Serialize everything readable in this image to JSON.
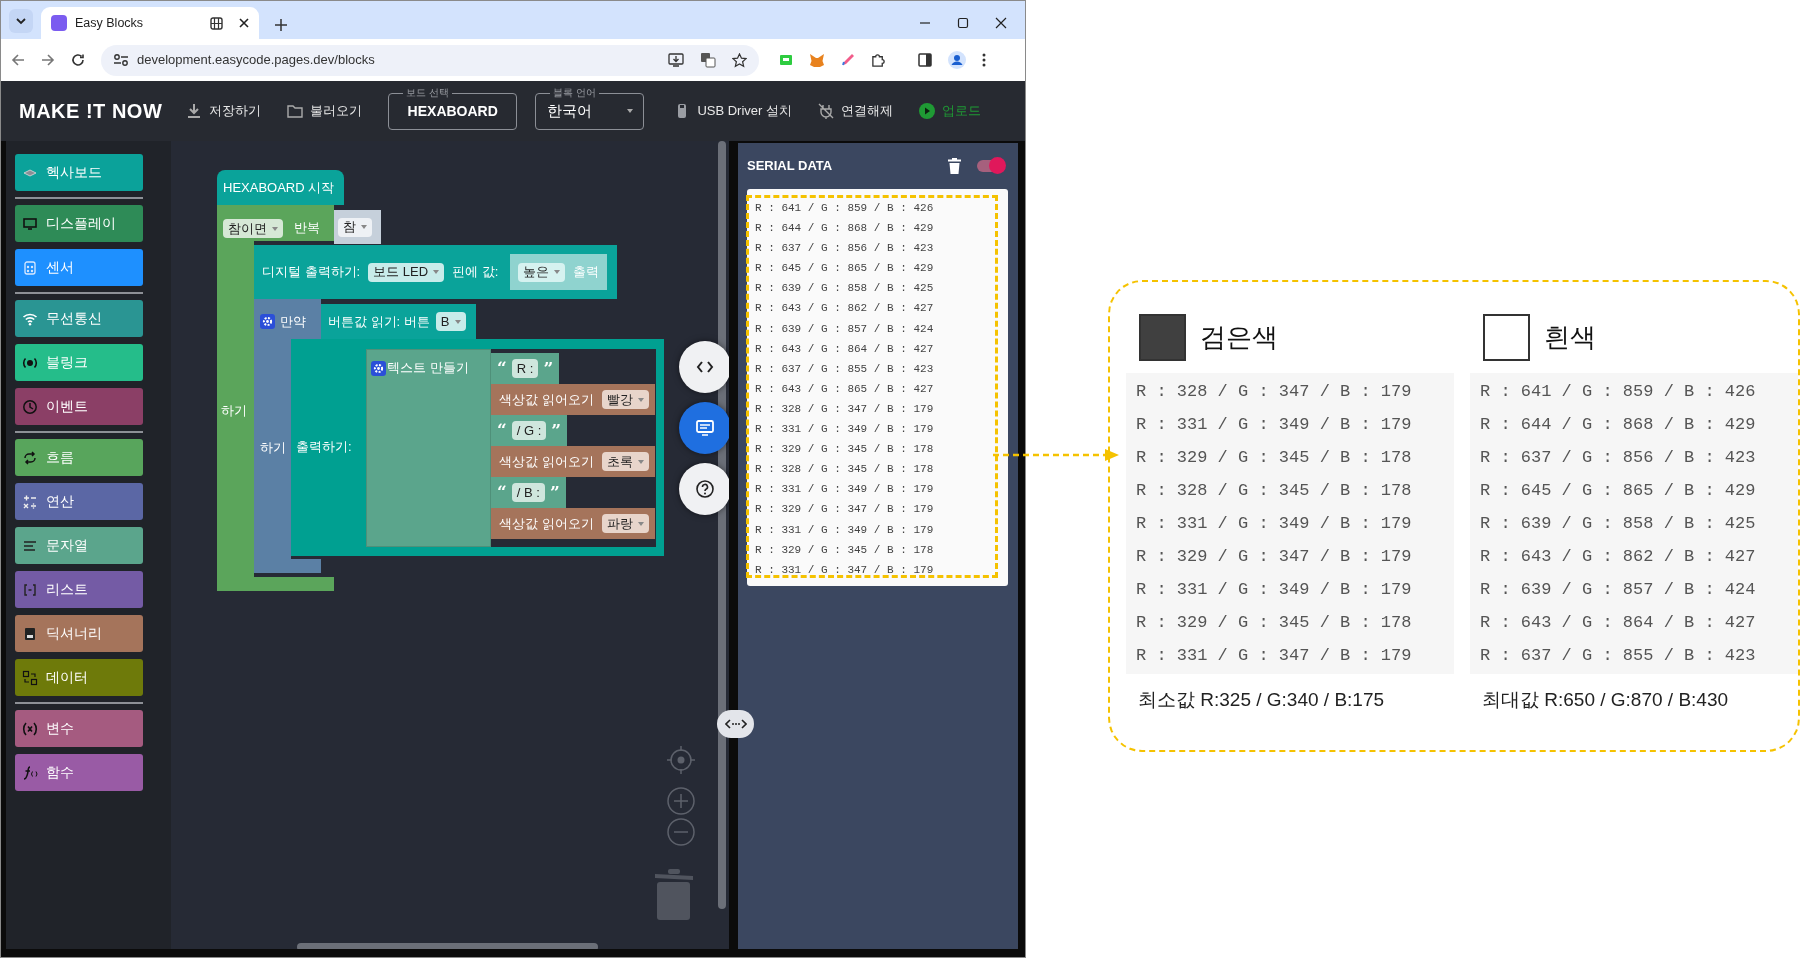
{
  "browser": {
    "tab_title": "Easy Blocks",
    "url": "development.easycode.pages.dev/blocks"
  },
  "app_bar": {
    "logo": "MAKE !T NOW",
    "file_actions": [
      {
        "kind": "save",
        "label": "저장하기"
      },
      {
        "kind": "open",
        "label": "불러오기"
      }
    ],
    "board_select": {
      "legend": "보드 선택",
      "value": "HEXABOARD"
    },
    "language_select": {
      "legend": "블록 언어",
      "value": "한국어"
    },
    "device_actions": [
      {
        "kind": "usb",
        "label": "USB Driver 설치"
      },
      {
        "kind": "disconnect",
        "label": "연결해제"
      },
      {
        "kind": "upload",
        "label": "업로드"
      }
    ]
  },
  "category_groups": [
    {
      "items": [
        {
          "kind": "chip",
          "label": "헥사보드",
          "color": "#0ba29a"
        }
      ]
    },
    {
      "items": [
        {
          "kind": "display",
          "label": "디스플레이",
          "color": "#2e8b57"
        },
        {
          "kind": "sensor",
          "label": "센서",
          "color": "#1e90ff"
        }
      ]
    },
    {
      "items": [
        {
          "kind": "wifi",
          "label": "무선통신",
          "color": "#2a9593"
        },
        {
          "kind": "iot",
          "label": "블링크",
          "color": "#25bd8a"
        },
        {
          "kind": "clock",
          "label": "이벤트",
          "color": "#8b3f66"
        }
      ]
    },
    {
      "items": [
        {
          "kind": "loop",
          "label": "흐름",
          "color": "#58a55c"
        },
        {
          "kind": "math",
          "label": "연산",
          "color": "#5b67a5"
        },
        {
          "kind": "text",
          "label": "문자열",
          "color": "#5ba58c"
        },
        {
          "kind": "list",
          "label": "리스트",
          "color": "#745ba5"
        },
        {
          "kind": "dict",
          "label": "딕셔너리",
          "color": "#a5745b"
        },
        {
          "kind": "data",
          "label": "데이터",
          "color": "#6e7a0a"
        }
      ]
    },
    {
      "items": [
        {
          "kind": "variable",
          "label": "변수",
          "color": "#a55b80"
        },
        {
          "kind": "function",
          "label": "함수",
          "color": "#995ba5"
        }
      ]
    }
  ],
  "workspace": {
    "start": {
      "label": "HEXABOARD 시작"
    },
    "loop": {
      "mode": "참이면",
      "label": "반복",
      "condition": "참",
      "do_label": "하기"
    },
    "digital_write": {
      "label": "디지털 출력하기:",
      "pin": "보드 LED",
      "value_label": "핀에 값:",
      "value": "높은",
      "value_suffix": "출력"
    },
    "if_block": {
      "label": "만약",
      "condition_label": "버튼값 읽기: 버튼",
      "button": "B",
      "do_label": "하기"
    },
    "print": {
      "label": "출력하기:"
    },
    "join": {
      "label": "텍스트 만들기",
      "parts": [
        {
          "kind": "text",
          "open": "“",
          "value": "R :",
          "close": "”"
        },
        {
          "kind": "color_read",
          "label": "색상값 읽어오기",
          "channel": "빨강"
        },
        {
          "kind": "text",
          "open": "“",
          "value": "/ G :",
          "close": "”"
        },
        {
          "kind": "color_read",
          "label": "색상값 읽어오기",
          "channel": "초록"
        },
        {
          "kind": "text",
          "open": "“",
          "value": "/ B :",
          "close": "”"
        },
        {
          "kind": "color_read",
          "label": "색상값 읽어오기",
          "channel": "파랑"
        }
      ]
    },
    "side_buttons": [
      {
        "kind": "code",
        "selected": false
      },
      {
        "kind": "console",
        "selected": true
      },
      {
        "kind": "help",
        "selected": false
      }
    ]
  },
  "serial": {
    "title": "SERIAL DATA",
    "enabled": true,
    "lines": [
      "R : 641 / G : 859 / B : 426",
      "R : 644 / G : 868 / B : 429",
      "R : 637 / G : 856 / B : 423",
      "R : 645 / G : 865 / B : 429",
      "R : 639 / G : 858 / B : 425",
      "R : 643 / G : 862 / B : 427",
      "R : 639 / G : 857 / B : 424",
      "R : 643 / G : 864 / B : 427",
      "R : 637 / G : 855 / B : 423",
      "R : 643 / G : 865 / B : 427",
      "R : 328 / G : 347 / B : 179",
      "R : 331 / G : 349 / B : 179",
      "R : 329 / G : 345 / B : 178",
      "R : 328 / G : 345 / B : 178",
      "R : 331 / G : 349 / B : 179",
      "R : 329 / G : 347 / B : 179",
      "R : 331 / G : 349 / B : 179",
      "R : 329 / G : 345 / B : 178",
      "R : 331 / G : 347 / B : 179"
    ]
  },
  "comparison": {
    "columns": [
      {
        "label": "검은색",
        "color": "#404040",
        "lines": [
          "R : 328 / G : 347 / B : 179",
          "R : 331 / G : 349 / B : 179",
          "R : 329 / G : 345 / B : 178",
          "R : 328 / G : 345 / B : 178",
          "R : 331 / G : 349 / B : 179",
          "R : 329 / G : 347 / B : 179",
          "R : 331 / G : 349 / B : 179",
          "R : 329 / G : 345 / B : 178",
          "R : 331 / G : 347 / B : 179"
        ],
        "summary": "최소값 R:325 / G:340 / B:175"
      },
      {
        "label": "흰색",
        "color": "#ffffff",
        "lines": [
          "R : 641 / G : 859 / B : 426",
          "R : 644 / G : 868 / B : 429",
          "R : 637 / G : 856 / B : 423",
          "R : 645 / G : 865 / B : 429",
          "R : 639 / G : 858 / B : 425",
          "R : 643 / G : 862 / B : 427",
          "R : 639 / G : 857 / B : 424",
          "R : 643 / G : 864 / B : 427",
          "R : 637 / G : 855 / B : 423"
        ],
        "summary": "최대값 R:650 / G:870 / B:430"
      }
    ]
  }
}
